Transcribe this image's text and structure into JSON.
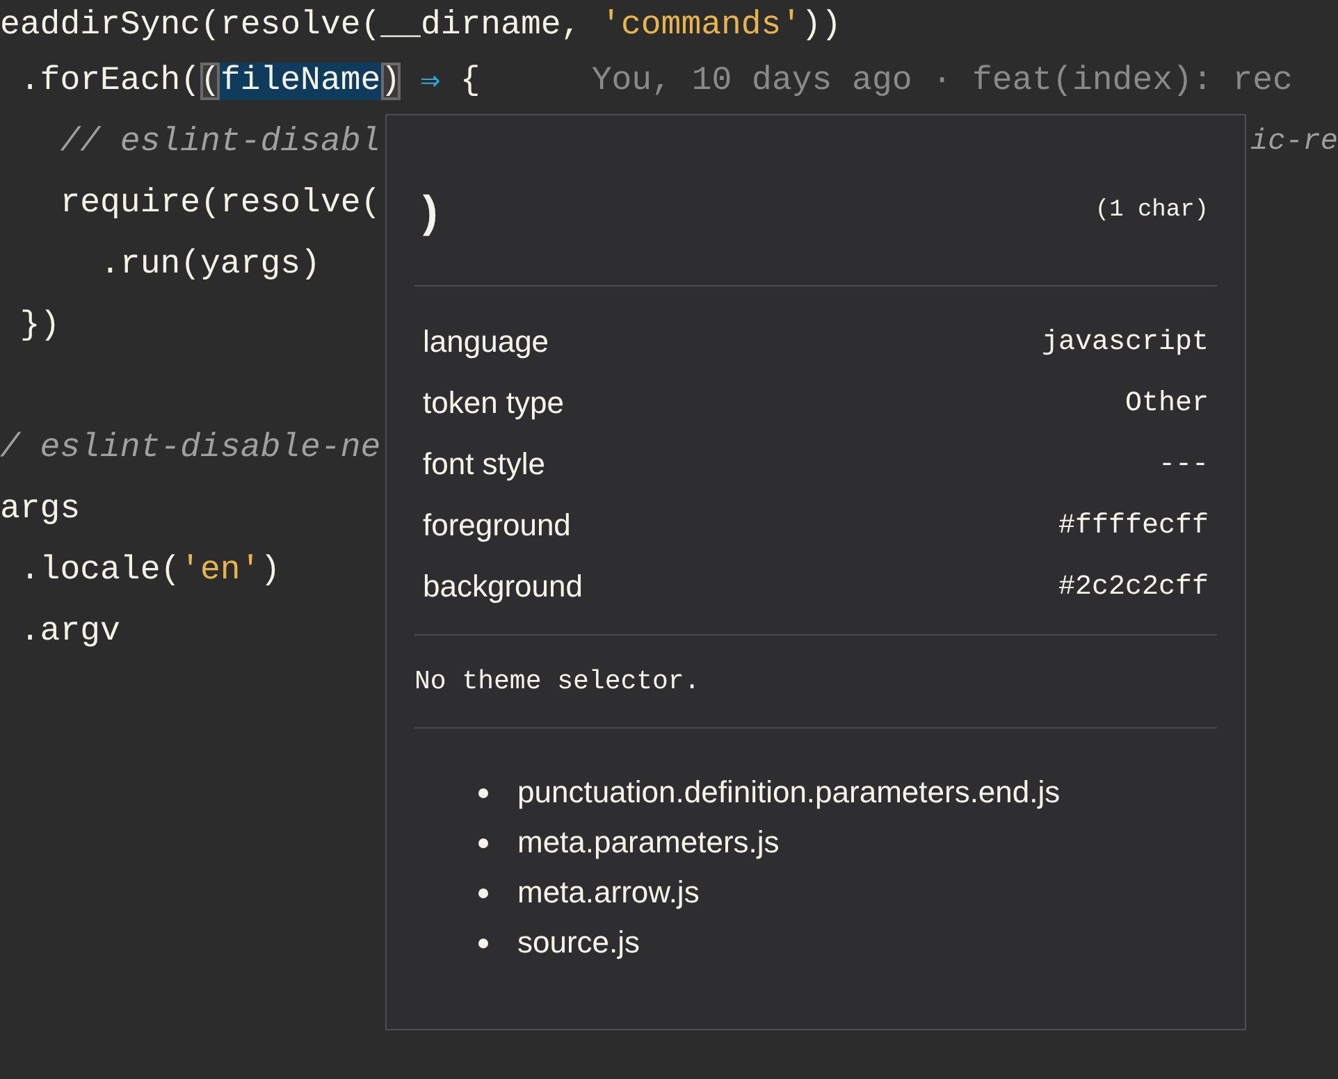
{
  "code_blocks": [
    {
      "lines": [
        {
          "segments": [
            {
              "text": "eaddirSync(resolve(__dirname, ",
              "kind": "plain"
            },
            {
              "text": "'commands'",
              "kind": "string"
            },
            {
              "text": "))",
              "kind": "plain"
            }
          ]
        },
        {
          "segments": [
            {
              "text": " .forEach(",
              "kind": "plain"
            },
            {
              "text": "(",
              "kind": "bracket_match"
            },
            {
              "text": "fileName",
              "kind": "selection"
            },
            {
              "text": ")",
              "kind": "bracket_match"
            },
            {
              "text": "⇒",
              "kind": "arrow"
            },
            {
              "text": " {",
              "kind": "plain"
            }
          ],
          "blame": "You, 10 days ago · feat(index): rec"
        },
        {
          "segments": [
            {
              "text": "   // eslint-disabl",
              "kind": "comment"
            }
          ],
          "right_text": "ic-re"
        },
        {
          "segments": [
            {
              "text": "   require(resolve(",
              "kind": "plain"
            }
          ]
        },
        {
          "segments": [
            {
              "text": "     .run(yargs)",
              "kind": "plain"
            }
          ]
        },
        {
          "segments": [
            {
              "text": " })",
              "kind": "plain"
            }
          ]
        }
      ]
    },
    {
      "lines": [
        {
          "segments": [
            {
              "text": "/ eslint-disable-ne",
              "kind": "comment"
            }
          ]
        },
        {
          "segments": [
            {
              "text": "args",
              "kind": "plain"
            }
          ]
        },
        {
          "segments": [
            {
              "text": " .locale(",
              "kind": "plain"
            },
            {
              "text": "'en'",
              "kind": "string"
            },
            {
              "text": ")",
              "kind": "plain"
            }
          ]
        },
        {
          "segments": [
            {
              "text": " .argv",
              "kind": "plain"
            }
          ]
        }
      ]
    }
  ],
  "inspector": {
    "token": ")",
    "length": "(1 char)",
    "properties": [
      {
        "label": "language",
        "value": "javascript"
      },
      {
        "label": "token type",
        "value": "Other"
      },
      {
        "label": "font style",
        "value": "---"
      },
      {
        "label": "foreground",
        "value": "#ffffecff"
      },
      {
        "label": "background",
        "value": "#2c2c2cff"
      }
    ],
    "theme_note": "No theme selector.",
    "scopes": [
      "punctuation.definition.parameters.end.js",
      "meta.parameters.js",
      "meta.arrow.js",
      "source.js"
    ]
  }
}
